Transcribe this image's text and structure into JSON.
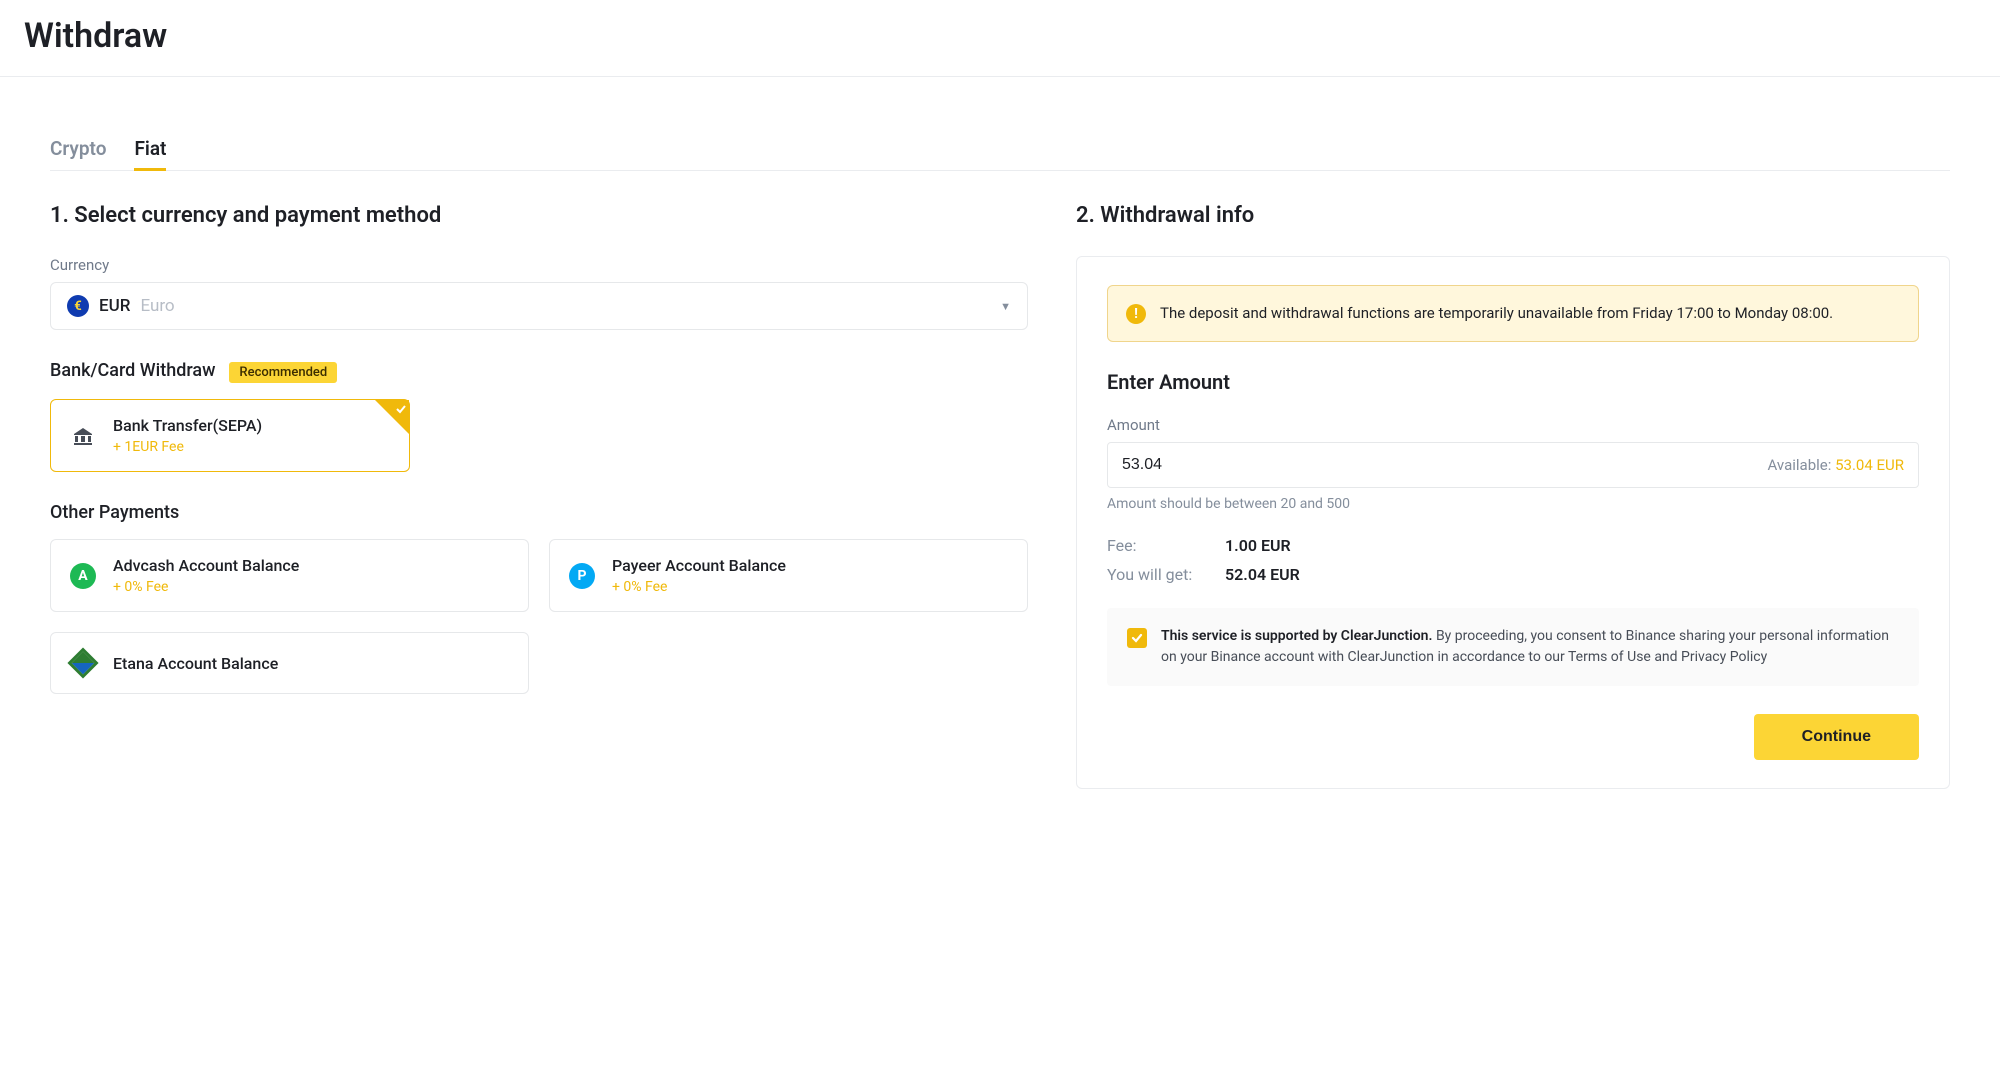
{
  "page": {
    "title": "Withdraw"
  },
  "tabs": {
    "crypto": "Crypto",
    "fiat": "Fiat"
  },
  "left": {
    "heading": "1. Select currency and payment method",
    "currency_label": "Currency",
    "currency_code": "EUR",
    "currency_name": "Euro",
    "bankcard_title": "Bank/Card Withdraw",
    "recommended_badge": "Recommended",
    "sepa": {
      "name": "Bank Transfer(SEPA)",
      "fee": "+ 1EUR Fee"
    },
    "other_title": "Other Payments",
    "advcash": {
      "name": "Advcash Account Balance",
      "fee": "+ 0% Fee"
    },
    "payeer": {
      "name": "Payeer Account Balance",
      "fee": "+ 0% Fee"
    },
    "etana": {
      "name": "Etana Account Balance"
    }
  },
  "right": {
    "heading": "2. Withdrawal info",
    "alert": "The deposit and withdrawal functions are temporarily unavailable from Friday 17:00 to Monday 08:00.",
    "enter_amount": "Enter Amount",
    "amount_label": "Amount",
    "amount_value": "53.04",
    "available_label": "Available: ",
    "available_value": "53.04 EUR",
    "hint": "Amount should be between 20 and 500",
    "fee_label": "Fee:",
    "fee_value": "1.00 EUR",
    "get_label": "You will get:",
    "get_value": "52.04 EUR",
    "consent_bold": "This service is supported by ClearJunction.",
    "consent_rest": " By proceeding, you consent to Binance sharing your personal information on your Binance account with ClearJunction in accordance to our Terms of Use and Privacy Policy",
    "continue": "Continue"
  }
}
